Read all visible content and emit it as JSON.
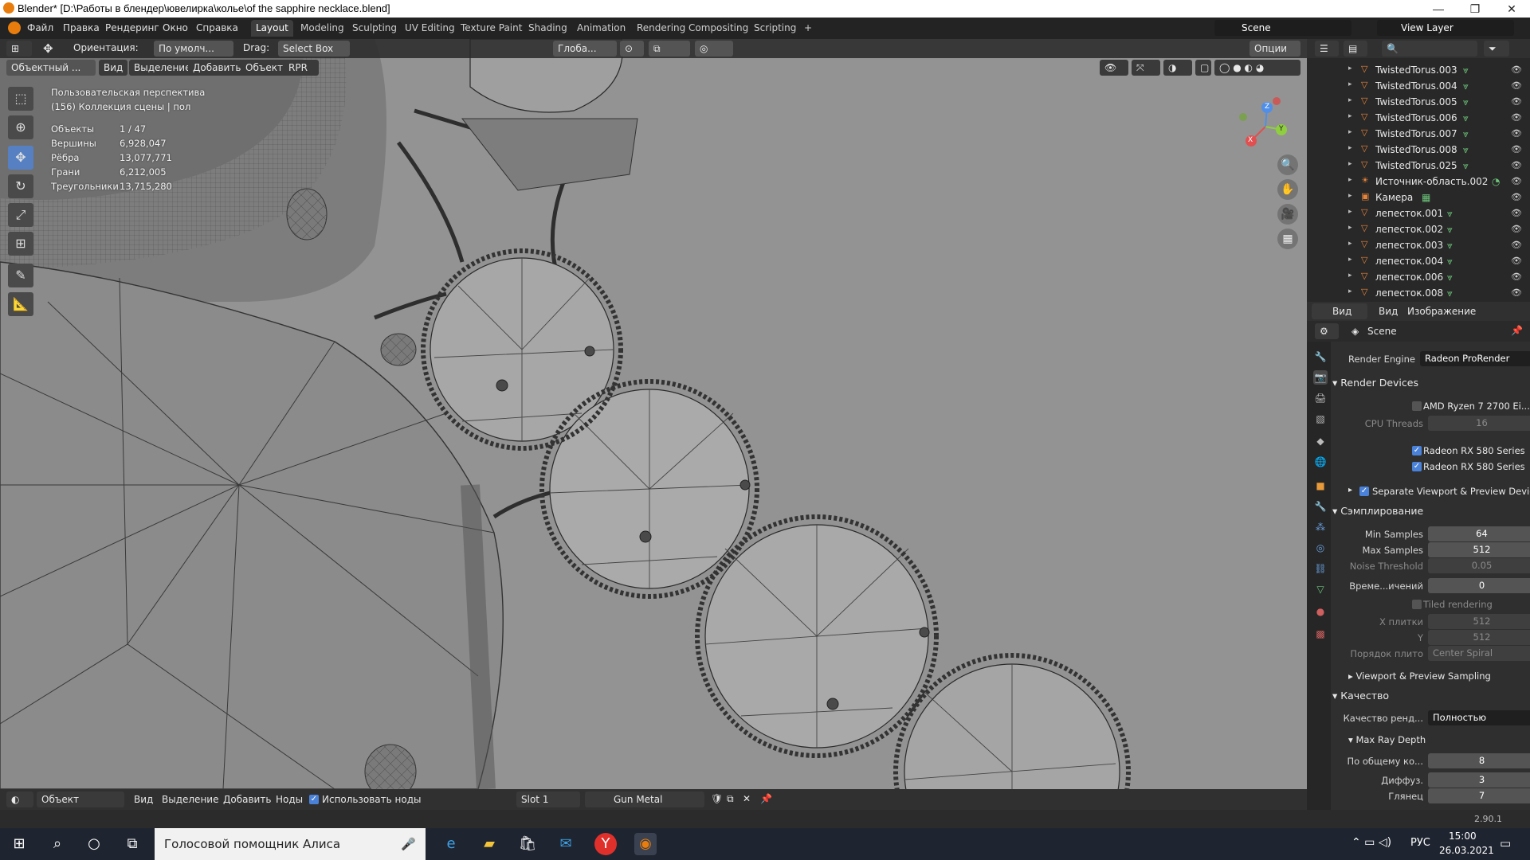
{
  "window": {
    "title": "Blender* [D:\\Работы в блендер\\ювелирка\\колье\\of the sapphire necklace.blend]"
  },
  "menu": {
    "items": [
      "Файл",
      "Правка",
      "Рендеринг",
      "Окно",
      "Справка"
    ]
  },
  "workspaces": [
    "Layout",
    "Modeling",
    "Sculpting",
    "UV Editing",
    "Texture Paint",
    "Shading",
    "Animation",
    "Rendering",
    "Compositing",
    "Scripting",
    "+"
  ],
  "scene_selector": {
    "scene": "Scene",
    "view_layer": "View Layer"
  },
  "viewport_header": {
    "orientation_label": "Ориентация:",
    "orientation_value": "По умолч...",
    "drag_label": "Drag:",
    "drag_value": "Select Box",
    "transform": "Глоба...",
    "options": "Опции",
    "mode": "Объектный ...",
    "menus": [
      "Вид",
      "Выделение",
      "Добавить",
      "Объект",
      "RPR"
    ]
  },
  "overlay": {
    "view_name": "Пользовательская перспектива",
    "collection": "(156) Коллекция сцены | пол",
    "stats": [
      {
        "label": "Объекты",
        "value": "1 / 47"
      },
      {
        "label": "Вершины",
        "value": "6,928,047"
      },
      {
        "label": "Рёбра",
        "value": "13,077,771"
      },
      {
        "label": "Грани",
        "value": "6,212,005"
      },
      {
        "label": "Треугольники",
        "value": "13,715,280"
      }
    ]
  },
  "gizmo": {
    "x": "X",
    "y": "Y",
    "z": "Z"
  },
  "outliner": {
    "items": [
      {
        "name": "TwistedTorus.003",
        "type": "mesh"
      },
      {
        "name": "TwistedTorus.004",
        "type": "mesh"
      },
      {
        "name": "TwistedTorus.005",
        "type": "mesh"
      },
      {
        "name": "TwistedTorus.006",
        "type": "mesh"
      },
      {
        "name": "TwistedTorus.007",
        "type": "mesh"
      },
      {
        "name": "TwistedTorus.008",
        "type": "mesh"
      },
      {
        "name": "TwistedTorus.025",
        "type": "mesh"
      },
      {
        "name": "Источник-область.002",
        "type": "light"
      },
      {
        "name": "Камера",
        "type": "camera"
      },
      {
        "name": "лепесток.001",
        "type": "mesh"
      },
      {
        "name": "лепесток.002",
        "type": "mesh"
      },
      {
        "name": "лепесток.003",
        "type": "mesh"
      },
      {
        "name": "лепесток.004",
        "type": "mesh"
      },
      {
        "name": "лепесток.006",
        "type": "mesh"
      },
      {
        "name": "лепесток.008",
        "type": "mesh"
      }
    ]
  },
  "props_header": {
    "view": "Вид",
    "menu_view": "Вид",
    "menu_image": "Изображение"
  },
  "properties": {
    "scene": "Scene",
    "render_engine_label": "Render Engine",
    "render_engine": "Radeon ProRender",
    "render_devices_title": "Render Devices",
    "cpu_name": "AMD Ryzen 7 2700 Ei...",
    "cpu_threads_label": "CPU Threads",
    "cpu_threads": "16",
    "gpu1": "Radeon RX 580 Series",
    "gpu2": "Radeon RX 580 Series",
    "separate": "Separate Viewport & Preview Devices",
    "sampling_title": "Сэмплирование",
    "min_samples_label": "Min Samples",
    "min_samples": "64",
    "max_samples_label": "Max Samples",
    "max_samples": "512",
    "noise_label": "Noise Threshold",
    "noise": "0.05",
    "time_label": "Време...ичений",
    "time": "0",
    "tiled": "Tiled rendering",
    "tile_x_label": "X плитки",
    "tile_x": "512",
    "tile_y_label": "Y",
    "tile_y": "512",
    "tile_order_label": "Порядок плито",
    "tile_order": "Center Spiral",
    "vp_sampling": "Viewport & Preview Sampling",
    "quality_title": "Качество",
    "quality_label": "Качество ренд...",
    "quality_value": "Полностью",
    "ray_depth_title": "Max Ray Depth",
    "total_label": "По общему ко...",
    "total": "8",
    "diffuse_label": "Диффуз.",
    "diffuse": "3",
    "glossy_label": "Глянец",
    "glossy": "7"
  },
  "node_header": {
    "mode": "Объект",
    "menus": [
      "Вид",
      "Выделение",
      "Добавить",
      "Ноды"
    ],
    "use_nodes": "Использовать ноды",
    "slot": "Slot 1",
    "material": "Gun Metal"
  },
  "status": {
    "version": "2.90.1"
  },
  "taskbar": {
    "assistant": "Голосовой помощник Алиса",
    "lang": "РУС",
    "time": "15:00",
    "date": "26.03.2021"
  },
  "colors": {
    "accent": "#5680c2",
    "viewport_bg": "#939393",
    "panel_bg": "#2f2f2f",
    "outliner_bg": "#282828"
  }
}
